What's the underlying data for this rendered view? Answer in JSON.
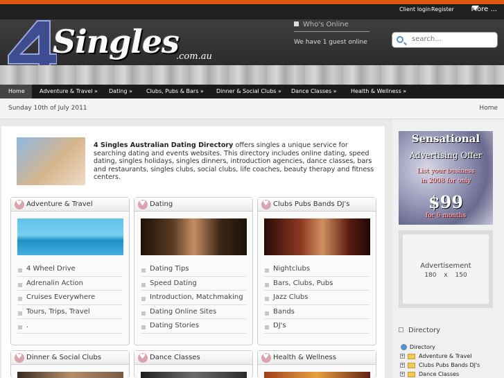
{
  "topbar": {
    "client_login": "Client login",
    "register": "Register",
    "more": "More ..."
  },
  "logo": {
    "main": "Singles",
    "domain": ".com.au"
  },
  "whos_online": {
    "title": "Who's Online",
    "text": "We have 1 guest online"
  },
  "search": {
    "placeholder": "search..."
  },
  "nav": [
    "Home",
    "Adventure & Travel »",
    "Dating »",
    "Clubs, Pubs & Bars »",
    "Dinner & Social Clubs »",
    "Dance Classes »",
    "Health & Wellness »"
  ],
  "datebar": {
    "date": "Sunday 10th of July 2011",
    "breadcrumb": "Home"
  },
  "intro": {
    "bold": "4 Singles Australian Dating Directory",
    "text": " offers singles a unique service for searching dating and events websites. This directory includes online dating, speed dating, singles holidays, singles dinners, introduction agencies, dance classes, bars and restaurants, singles clubs, social clubs, life coaches, beauty therapy and fitness centers."
  },
  "cards": [
    {
      "title": "Adventure & Travel",
      "items": [
        "4 Wheel Drive",
        "Adrenalin Action",
        "Cruises Everywhere",
        "Tours, Trips, Travel",
        "."
      ]
    },
    {
      "title": "Dating",
      "items": [
        "Dating Tips",
        "Speed Dating",
        "Introduction, Matchmaking",
        "Dating Online Sites",
        "Dating Stories"
      ]
    },
    {
      "title": "Clubs Pubs Bands DJ's",
      "items": [
        "Nightclubs",
        "Bars, Clubs, Pubs",
        "Jazz Clubs",
        "Bands",
        "DJ's"
      ]
    },
    {
      "title": "Dinner & Social Clubs",
      "items": []
    },
    {
      "title": "Dance Classes",
      "items": []
    },
    {
      "title": "Health & Wellness",
      "items": []
    }
  ],
  "ad1": {
    "line1": "Sensational",
    "line2": "Advertising Offer",
    "line3": "List your business",
    "line4": "in 2008 for only",
    "price": "$99",
    "period": "for 6 months"
  },
  "ad2": {
    "label": "Advertisement",
    "w": "180",
    "x": "x",
    "h": "150"
  },
  "directory": {
    "title": "Directory",
    "root": "Directory",
    "items": [
      "Adventure & Travel",
      "Clubs Pubs Bands DJ's",
      "Dance Classes"
    ]
  }
}
